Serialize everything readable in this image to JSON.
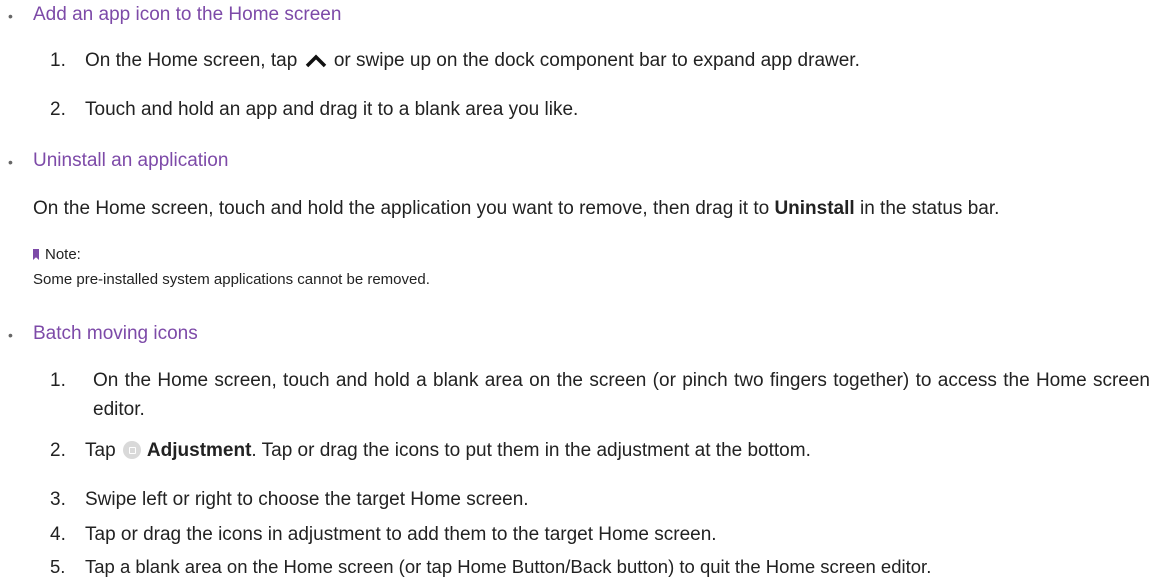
{
  "bullet_glyph": "•",
  "sections": {
    "add_icon": {
      "title": "Add an app icon to the Home screen",
      "steps": [
        {
          "num": "1.",
          "before": "On the Home screen, tap",
          "after": "or swipe up on the dock component bar to expand app drawer."
        },
        {
          "num": "2.",
          "text": "Touch and hold an app and drag it to a blank area you like."
        }
      ]
    },
    "uninstall": {
      "title": "Uninstall an application",
      "para_before": "On the Home screen, touch and hold the application you want to remove, then drag it to",
      "para_bold": "Uninstall",
      "para_after": "in the status bar.",
      "note_label": "Note:",
      "note_text": "Some pre-installed system applications cannot be removed."
    },
    "batch": {
      "title": "Batch moving icons",
      "steps": [
        {
          "num": "1.",
          "text": "On the Home screen, touch and hold a blank area on the screen (or pinch two fingers together) to access the Home screen editor."
        },
        {
          "num": "2.",
          "before": "Tap",
          "bold": "Adjustment",
          "after": ". Tap or drag the icons to put them in the adjustment at the bottom."
        },
        {
          "num": "3.",
          "text": "Swipe left or right to choose the target Home screen."
        },
        {
          "num": "4.",
          "text": "Tap or drag the icons in adjustment to add them to the target Home screen."
        },
        {
          "num": "5.",
          "text": "Tap a blank area on the Home screen (or tap Home Button/Back button) to quit the Home screen editor."
        }
      ]
    }
  },
  "colors": {
    "heading": "#7d4aa8",
    "text": "#222222",
    "icon_gray": "#d9d9d9"
  },
  "icons": [
    "chevron-up-icon",
    "bookmark-icon",
    "adjustment-icon"
  ]
}
